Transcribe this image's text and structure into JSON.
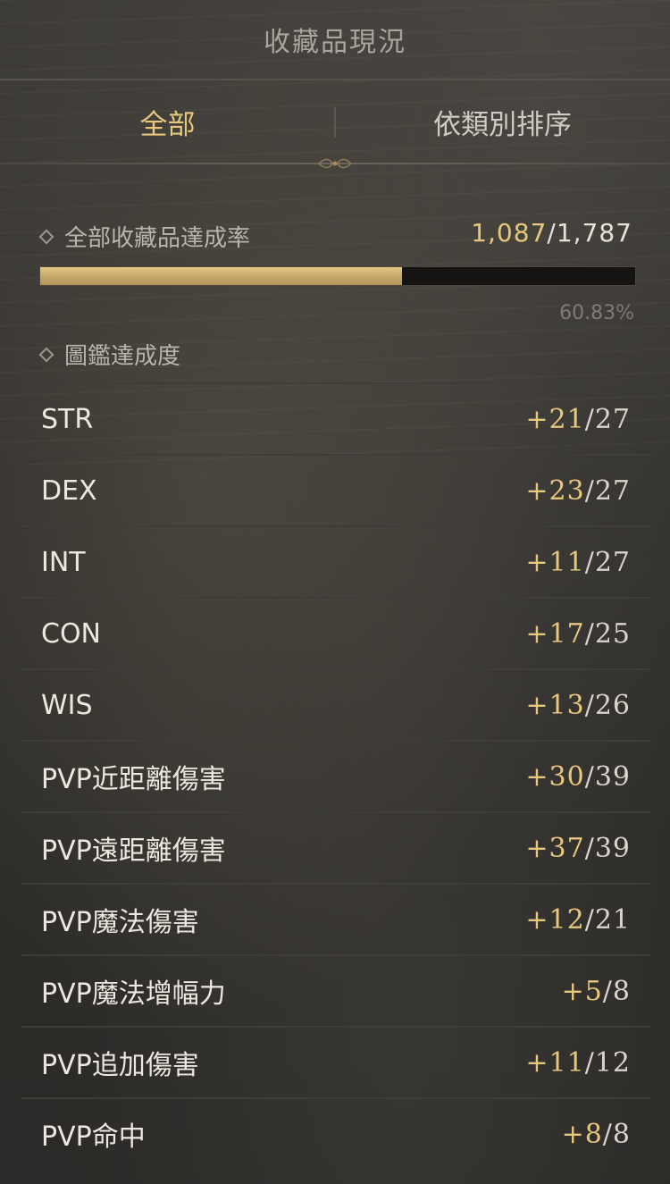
{
  "header": {
    "title": "收藏品現況"
  },
  "tabs": [
    {
      "label": "全部",
      "active": true
    },
    {
      "label": "依類別排序",
      "active": false
    }
  ],
  "overall": {
    "label": "全部收藏品達成率",
    "current": "1,087",
    "separator": "/",
    "total": "1,787",
    "percent_text": "60.83%",
    "progress": 0.6083
  },
  "codex": {
    "label": "圖鑑達成度"
  },
  "stats": [
    {
      "name": "STR",
      "current": "+21",
      "max": "27"
    },
    {
      "name": "DEX",
      "current": "+23",
      "max": "27"
    },
    {
      "name": "INT",
      "current": "+11",
      "max": "27"
    },
    {
      "name": "CON",
      "current": "+17",
      "max": "25"
    },
    {
      "name": "WIS",
      "current": "+13",
      "max": "26"
    },
    {
      "name": "PVP近距離傷害",
      "current": "+30",
      "max": "39"
    },
    {
      "name": "PVP遠距離傷害",
      "current": "+37",
      "max": "39"
    },
    {
      "name": "PVP魔法傷害",
      "current": "+12",
      "max": "21"
    },
    {
      "name": "PVP魔法增幅力",
      "current": "+5",
      "max": "8"
    },
    {
      "name": "PVP追加傷害",
      "current": "+11",
      "max": "12"
    },
    {
      "name": "PVP命中",
      "current": "+8",
      "max": "8"
    }
  ],
  "colors": {
    "accent_gold": "#e7c77c",
    "background": "#2f2e2b",
    "text": "#ece8e0",
    "muted": "#7f7b74"
  }
}
